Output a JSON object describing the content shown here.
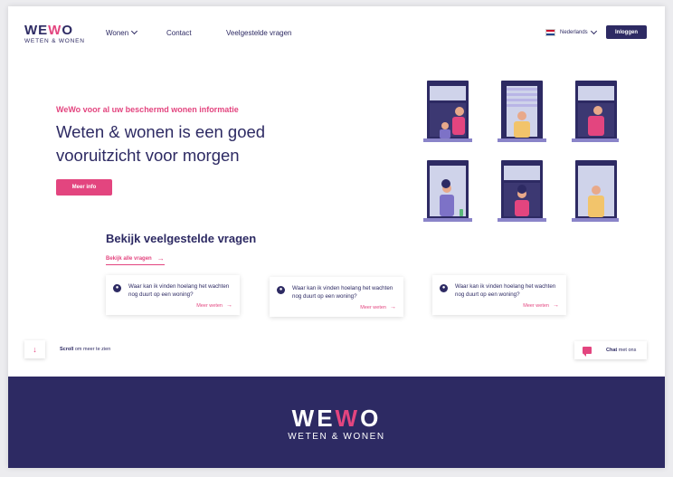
{
  "header": {
    "logo_main": [
      "WE",
      "W",
      "O"
    ],
    "logo_sub": "WETEN & WONEN",
    "nav": [
      "Wonen",
      "Contact",
      "Veelgestelde vragen"
    ],
    "language": "Nederlands",
    "login_label": "Inloggen"
  },
  "hero": {
    "eyebrow": "WeWo voor al uw beschermd wonen informatie",
    "title": "Weten & wonen is een goed vooruitzicht voor morgen",
    "cta_label": "Meer info"
  },
  "faq": {
    "title": "Bekijk veelgestelde vragen",
    "view_all_label": "Bekijk alle vragen",
    "cards": [
      {
        "question": "Waar kan ik vinden hoelang het wachten nog duurt op een woning?",
        "more_label": "Meer weten"
      },
      {
        "question": "Waar kan ik vinden hoelang het wachten nog duurt op een woning?",
        "more_label": "Meer weten"
      },
      {
        "question": "Waar kan ik vinden hoelang het wachten nog duurt op een woning?",
        "more_label": "Meer weten"
      }
    ]
  },
  "scroll": {
    "bold": "Scroll",
    "rest": " om meer te zien"
  },
  "chat": {
    "bold": "Chat",
    "rest": " met ons"
  },
  "footer": {
    "logo_main": [
      "WE",
      "W",
      "O"
    ],
    "logo_sub": "WETEN & WONEN"
  },
  "colors": {
    "brand": "#2d2a63",
    "accent": "#e3457f"
  },
  "icons": {
    "scroll": "arrow-down-icon",
    "chat": "chat-bubble-icon",
    "faq": "person-icon"
  }
}
